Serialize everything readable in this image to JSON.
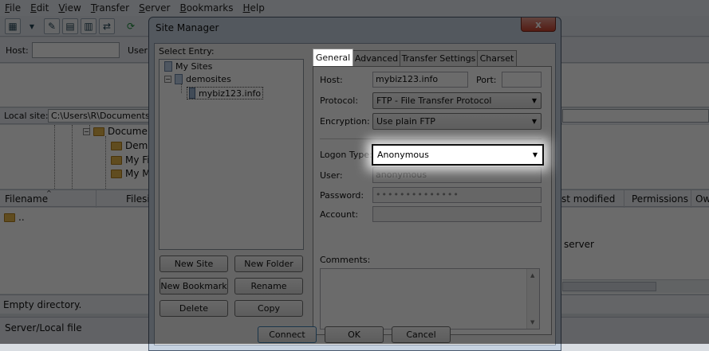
{
  "app": {
    "menu": [
      {
        "label": "File",
        "u": "F",
        "rest": "ile"
      },
      {
        "label": "Edit",
        "u": "E",
        "rest": "dit"
      },
      {
        "label": "View",
        "u": "V",
        "rest": "iew"
      },
      {
        "label": "Transfer",
        "u": "T",
        "rest": "ransfer"
      },
      {
        "label": "Server",
        "u": "S",
        "rest": "erver"
      },
      {
        "label": "Bookmarks",
        "u": "B",
        "rest": "ookmarks"
      },
      {
        "label": "Help",
        "u": "H",
        "rest": "elp"
      }
    ],
    "quickconnect": {
      "host_label": "Host:",
      "user_label": "User"
    },
    "local_site": {
      "label": "Local site:",
      "path": "C:\\Users\\R\\Documents\\W"
    },
    "local_tree": {
      "items": [
        "Docume",
        "Demo",
        "My Fi",
        "My M"
      ]
    },
    "file_list": {
      "columns": [
        "Filename",
        "Filesi",
        "st modified",
        "Permissions",
        "Ow"
      ],
      "rows": [
        ".."
      ],
      "remote_msg": "server"
    },
    "status": {
      "directory": "Empty directory.",
      "queue_header": "Server/Local file"
    }
  },
  "dialog": {
    "title": "Site Manager",
    "close_label": "x",
    "select_entry_label": "Select Entry:",
    "tree": {
      "root": "My Sites",
      "folder": "demosites",
      "site": "mybiz123.info"
    },
    "buttons": {
      "new_site": "New Site",
      "new_folder": "New Folder",
      "new_bookmark": "New Bookmark",
      "rename": "Rename",
      "delete": "Delete",
      "copy": "Copy",
      "connect": "Connect",
      "ok": "OK",
      "cancel": "Cancel"
    },
    "tabs": [
      "General",
      "Advanced",
      "Transfer Settings",
      "Charset"
    ],
    "general": {
      "host_label": "Host:",
      "host_value": "mybiz123.info",
      "port_label": "Port:",
      "port_value": "",
      "protocol_label": "Protocol:",
      "protocol_value": "FTP - File Transfer Protocol",
      "encryption_label": "Encryption:",
      "encryption_value": "Use plain FTP",
      "logon_type_label": "Logon Type:",
      "logon_type_value": "Anonymous",
      "user_label": "User:",
      "user_value": "anonymous",
      "password_label": "Password:",
      "password_value": "••••••••••••••",
      "account_label": "Account:",
      "account_value": "",
      "comments_label": "Comments:"
    }
  }
}
